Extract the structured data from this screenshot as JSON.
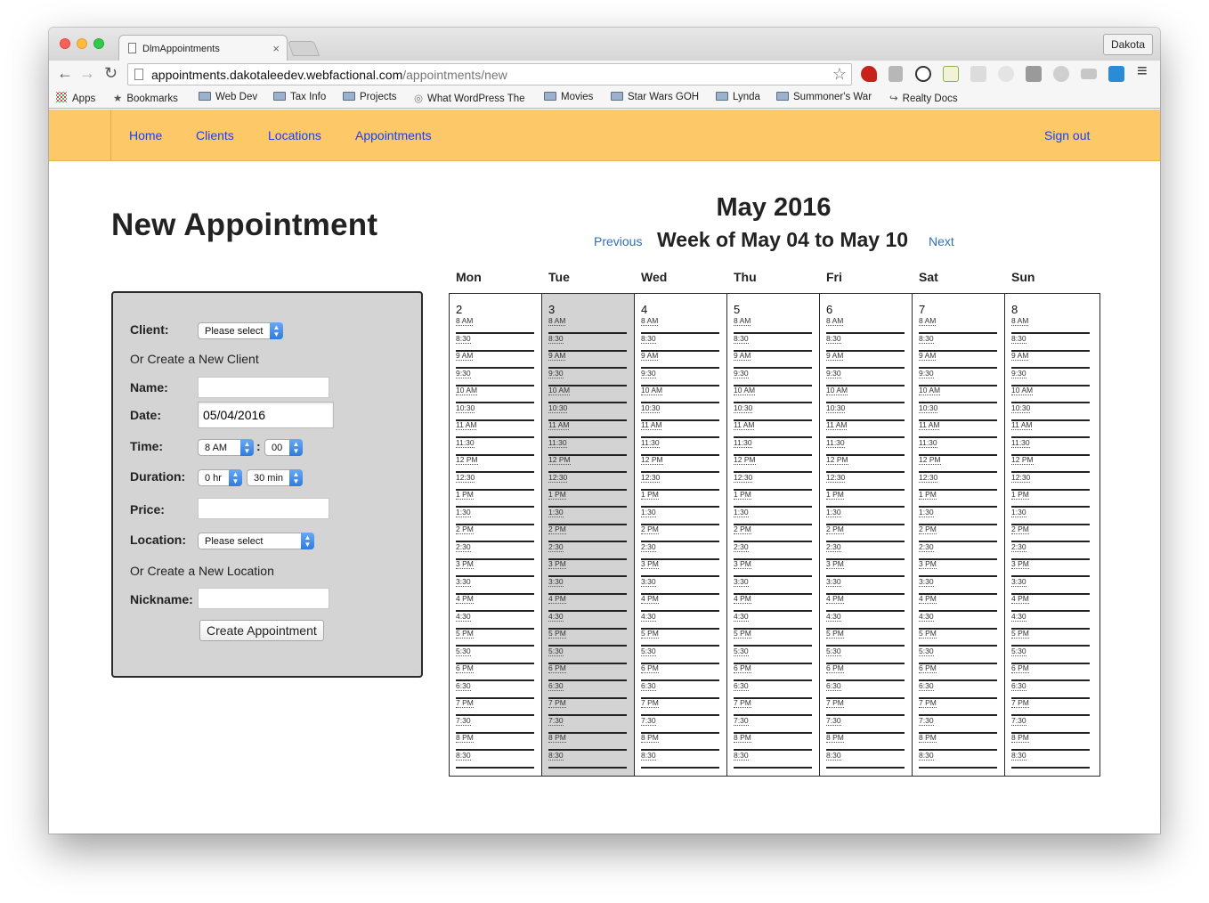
{
  "browser": {
    "tab_title": "DlmAppointments",
    "tab_close": "×",
    "profile": "Dakota",
    "url_host": "appointments.dakotaleedev.webfactional.com",
    "url_path": "/appointments/new",
    "back_glyph": "←",
    "forward_glyph": "→",
    "reload_glyph": "↻",
    "star_glyph": "☆",
    "menu_glyph": "≡",
    "bookmarks": [
      "Apps",
      "Bookmarks",
      "Web Dev",
      "Tax Info",
      "Projects",
      "What WordPress The",
      "Movies",
      "Star Wars GOH",
      "Lynda",
      "Summoner's War",
      "Realty Docs"
    ]
  },
  "nav": {
    "home": "Home",
    "clients": "Clients",
    "locations": "Locations",
    "appointments": "Appointments",
    "signout": "Sign out",
    "accent_color": "#fdc968",
    "link_color": "#1a3ff0"
  },
  "page": {
    "title": "New Appointment"
  },
  "form": {
    "client_label": "Client:",
    "client_value": "Please select",
    "create_client": "Or Create a New Client",
    "name_label": "Name:",
    "name_value": "",
    "date_label": "Date:",
    "date_value": "05/04/2016",
    "time_label": "Time:",
    "time_hour": "8 AM",
    "time_colon": ":",
    "time_minute": "00",
    "duration_label": "Duration:",
    "duration_hr": "0 hr",
    "duration_min": "30 min",
    "price_label": "Price:",
    "price_value": "",
    "location_label": "Location:",
    "location_value": "Please select",
    "create_location": "Or Create a New Location",
    "nickname_label": "Nickname:",
    "nickname_value": "",
    "submit": "Create Appointment"
  },
  "calendar": {
    "month": "May 2016",
    "week": "Week of May 04 to May 10",
    "previous": "Previous",
    "next": "Next",
    "selected_day": "Tue",
    "days": [
      {
        "name": "Mon",
        "num": "2"
      },
      {
        "name": "Tue",
        "num": "3"
      },
      {
        "name": "Wed",
        "num": "4"
      },
      {
        "name": "Thu",
        "num": "5"
      },
      {
        "name": "Fri",
        "num": "6"
      },
      {
        "name": "Sat",
        "num": "7"
      },
      {
        "name": "Sun",
        "num": "8"
      }
    ],
    "slots": [
      "8 AM",
      "8:30",
      "9 AM",
      "9:30",
      "10 AM",
      "10:30",
      "11 AM",
      "11:30",
      "12 PM",
      "12:30",
      "1 PM",
      "1:30",
      "2 PM",
      "2:30",
      "3 PM",
      "3:30",
      "4 PM",
      "4:30",
      "5 PM",
      "5:30",
      "6 PM",
      "6:30",
      "7 PM",
      "7:30",
      "8 PM",
      "8:30"
    ]
  }
}
